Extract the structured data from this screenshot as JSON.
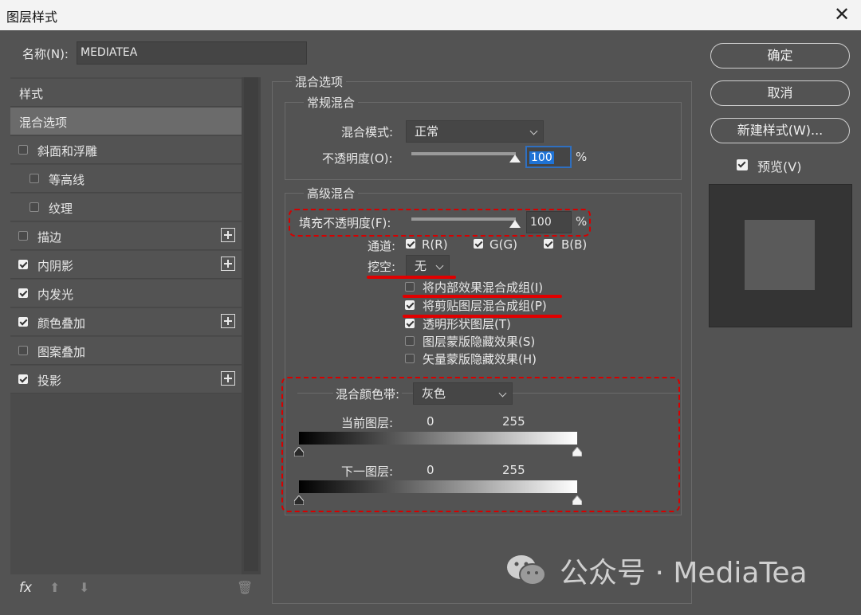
{
  "window": {
    "title": "图层样式",
    "close": "✕"
  },
  "name_field": {
    "label": "名称(N):",
    "value": "MEDIATEA"
  },
  "sidebar": {
    "header": "样式",
    "items": [
      {
        "label": "混合选项"
      },
      {
        "label": "斜面和浮雕"
      },
      {
        "label": "等高线"
      },
      {
        "label": "纹理"
      },
      {
        "label": "描边"
      },
      {
        "label": "内阴影"
      },
      {
        "label": "内发光"
      },
      {
        "label": "颜色叠加"
      },
      {
        "label": "图案叠加"
      },
      {
        "label": "投影"
      }
    ],
    "footer": {
      "fx": "fx",
      "up": "⬆",
      "down": "⬇",
      "trash": "🗑"
    }
  },
  "blend_options": {
    "title": "混合选项",
    "general": {
      "title": "常规混合",
      "mode_label": "混合模式:",
      "mode_value": "正常",
      "opacity_label": "不透明度(O):",
      "opacity_value": "100",
      "unit": "%"
    },
    "advanced": {
      "title": "高级混合",
      "fill_label": "填充不透明度(F):",
      "fill_value": "100",
      "unit": "%",
      "channels_label": "通道:",
      "channels": [
        "R(R)",
        "G(G)",
        "B(B)"
      ],
      "knockout_label": "挖空:",
      "knockout_value": "无",
      "options": [
        {
          "label": "将内部效果混合成组(I)",
          "checked": false
        },
        {
          "label": "将剪贴图层混合成组(P)",
          "checked": true
        },
        {
          "label": "透明形状图层(T)",
          "checked": true
        },
        {
          "label": "图层蒙版隐藏效果(S)",
          "checked": false
        },
        {
          "label": "矢量蒙版隐藏效果(H)",
          "checked": false
        }
      ]
    },
    "blend_if": {
      "label": "混合颜色带:",
      "value": "灰色",
      "this_layer": "当前图层:",
      "underlying": "下一图层:",
      "min": "0",
      "max": "255"
    }
  },
  "buttons": {
    "ok": "确定",
    "cancel": "取消",
    "new_style": "新建样式(W)...",
    "preview": "预览(V)"
  },
  "watermark": {
    "text": "公众号 · MediaTea"
  }
}
